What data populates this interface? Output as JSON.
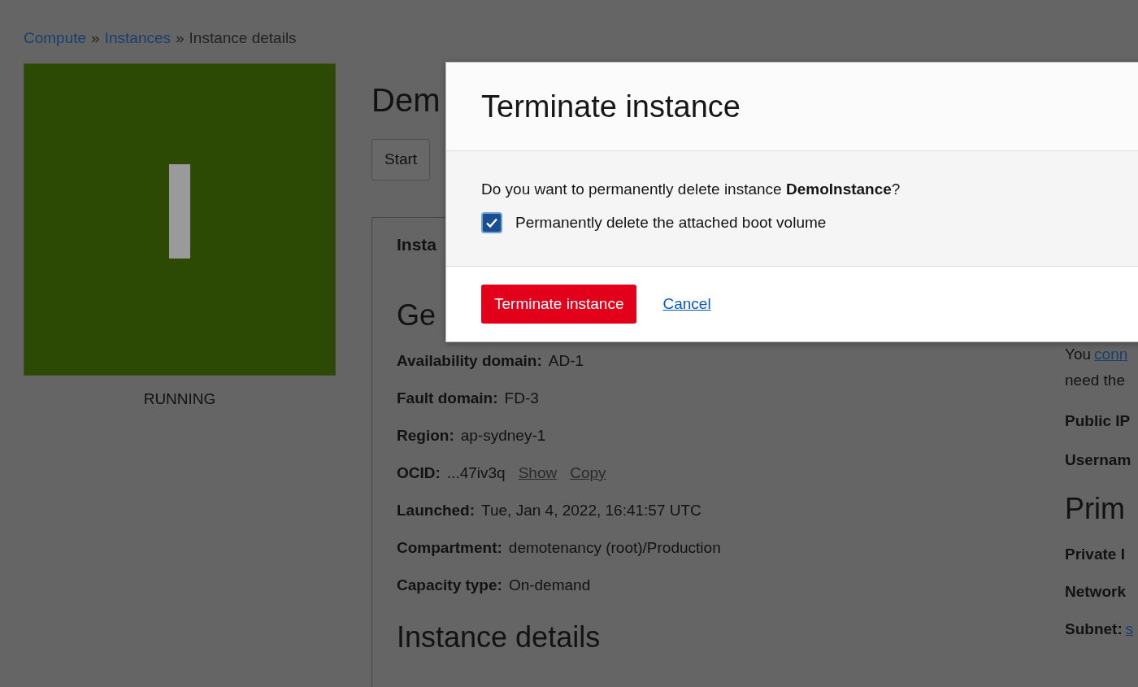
{
  "breadcrumb": {
    "separator": "»",
    "items": [
      {
        "label": "Compute",
        "link": true
      },
      {
        "label": "Instances",
        "link": true
      },
      {
        "label": "Instance details",
        "link": false
      }
    ]
  },
  "status_tile": {
    "state": "RUNNING"
  },
  "page": {
    "title": "Dem",
    "buttons": [
      "Start"
    ],
    "tab": "Insta",
    "section": "Ge",
    "fields": [
      {
        "label": "Availability domain:",
        "value": "AD-1"
      },
      {
        "label": "Fault domain:",
        "value": "FD-3"
      },
      {
        "label": "Region:",
        "value": "ap-sydney-1"
      },
      {
        "label": "OCID:",
        "value": "...47iv3q",
        "links": [
          "Show",
          "Copy"
        ]
      },
      {
        "label": "Launched:",
        "value": "Tue, Jan 4, 2022, 16:41:57 UTC"
      },
      {
        "label": "Compartment:",
        "value": "demotenancy (root)/Production"
      },
      {
        "label": "Capacity type:",
        "value": "On-demand"
      }
    ],
    "next_section": "Instance details"
  },
  "access": {
    "intro": [
      {
        "text": "You",
        "link": "conn"
      },
      {
        "text": "need the"
      }
    ],
    "fields": [
      {
        "label": "Public IP"
      },
      {
        "label": "Usernam"
      }
    ],
    "section": "Prim",
    "fields2": [
      {
        "label": "Private I"
      },
      {
        "label": "Network"
      },
      {
        "label": "Subnet:",
        "link": "s"
      }
    ]
  },
  "modal": {
    "title": "Terminate instance",
    "message": "Do you want to permanently delete instance **DemoInstance**?",
    "checkbox": {
      "label": "Permanently delete the attached boot volume",
      "checked": true
    },
    "primary": "Terminate instance",
    "cancel": "Cancel"
  }
}
